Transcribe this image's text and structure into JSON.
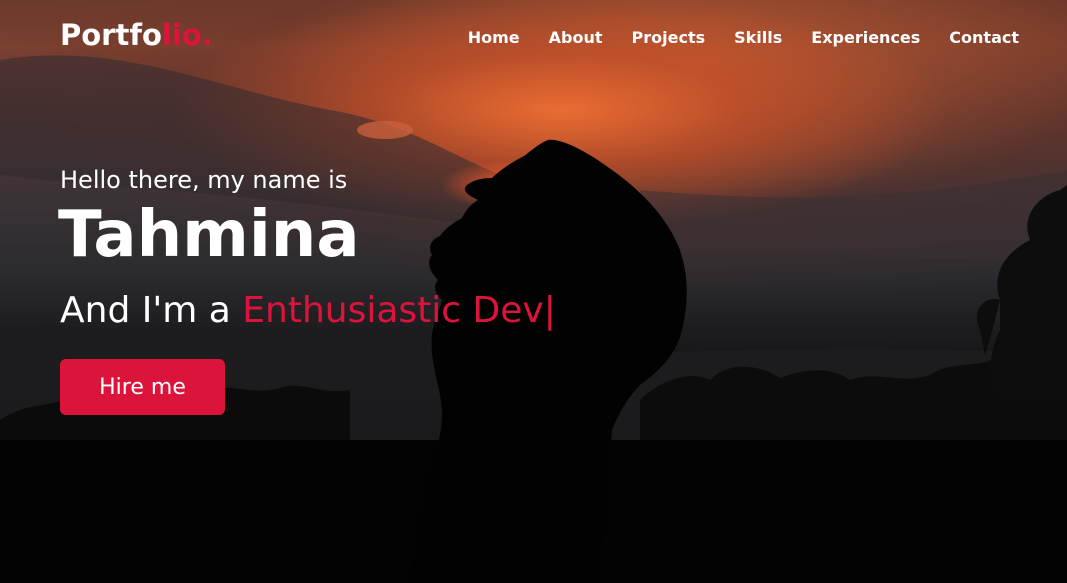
{
  "colors": {
    "accent": "#dc143c",
    "text": "#ffffff"
  },
  "navbar": {
    "logo_main": "Portfo",
    "logo_accent": "lio.",
    "links": [
      "Home",
      "About",
      "Projects",
      "Skills",
      "Experiences",
      "Contact"
    ]
  },
  "hero": {
    "greeting": "Hello there, my name is",
    "name": "Tahmina",
    "role_prefix": "And I'm a ",
    "role_typed": "Enthusiastic Dev",
    "cursor": "|",
    "button_label": "Hire me"
  },
  "background": {
    "image_subject": "silhouette-person-sunset"
  }
}
